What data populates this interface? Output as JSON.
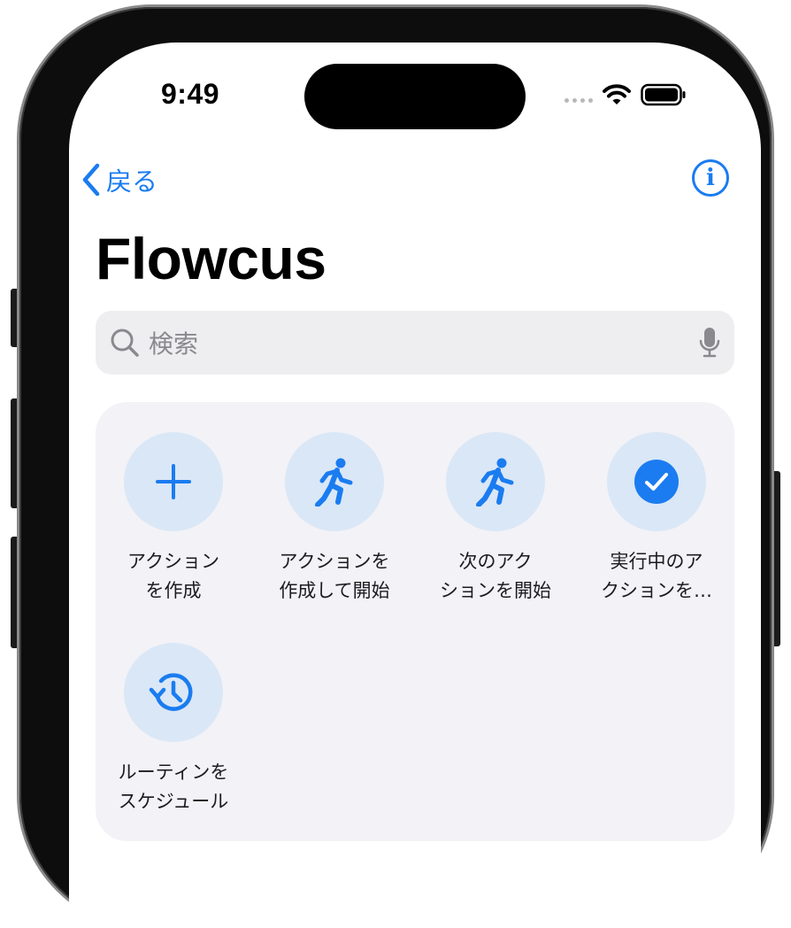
{
  "status_bar": {
    "time": "9:49"
  },
  "nav": {
    "back_label": "戻る",
    "info_glyph": "i"
  },
  "page": {
    "title": "Flowcus"
  },
  "search": {
    "placeholder": "検索"
  },
  "actions": [
    {
      "label": "アクション\nを作成",
      "icon": "plus-icon"
    },
    {
      "label": "アクションを\n作成して開始",
      "icon": "running-figure-icon"
    },
    {
      "label": "次のアク\nションを開始",
      "icon": "running-figure-icon"
    },
    {
      "label": "実行中のア\nクションを…",
      "icon": "checkmark-circle-icon"
    },
    {
      "label": "ルーティンを\nスケジュール",
      "icon": "history-clock-icon"
    }
  ],
  "colors": {
    "accent": "#1a7cf0",
    "icon_circle": "#dae7f6",
    "card": "#f2f2f7",
    "search_bg": "#eeeef0"
  }
}
